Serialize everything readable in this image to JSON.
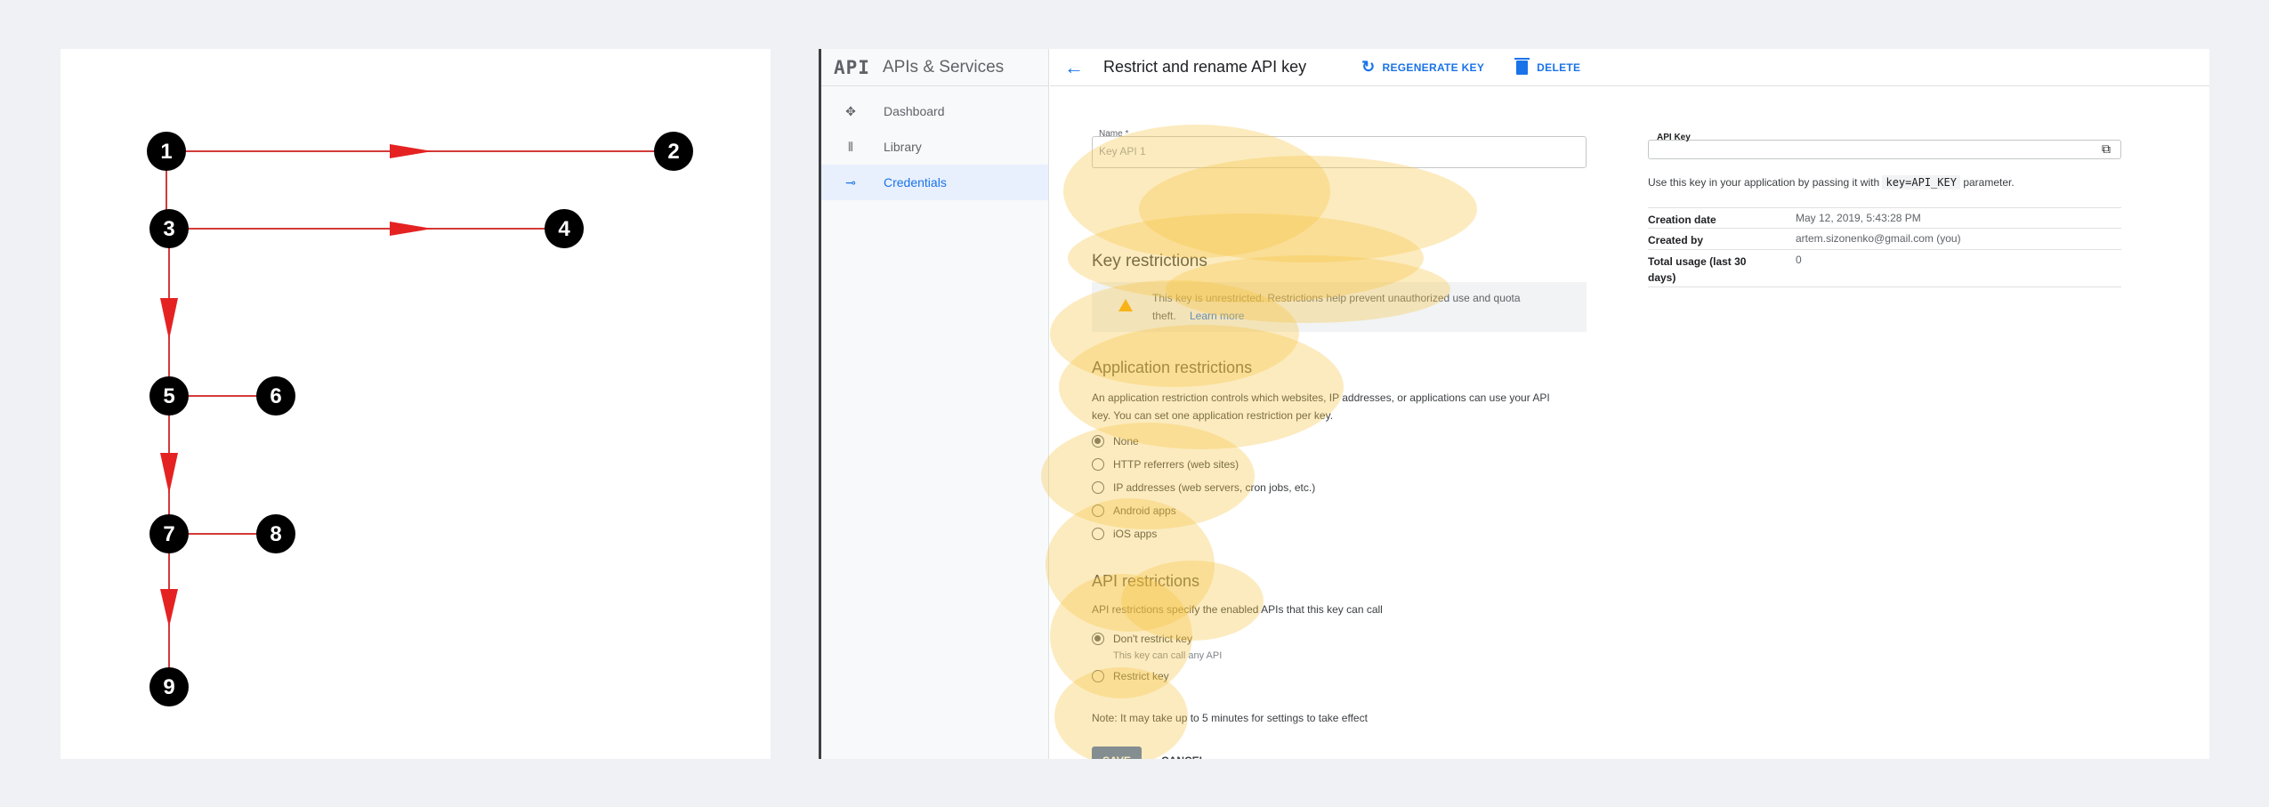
{
  "diagram": {
    "nodes": [
      "1",
      "2",
      "3",
      "4",
      "5",
      "6",
      "7",
      "8",
      "9"
    ]
  },
  "console": {
    "logo": "API",
    "sidebar_title": "APIs & Services",
    "nav": [
      {
        "label": "Dashboard",
        "icon": "dashboard-icon"
      },
      {
        "label": "Library",
        "icon": "library-icon"
      },
      {
        "label": "Credentials",
        "icon": "key-icon",
        "active": true
      }
    ],
    "page_title": "Restrict and rename API key",
    "regenerate_label": "REGENERATE KEY",
    "delete_label": "DELETE",
    "name_field": {
      "label": "Name *",
      "value": "Key API 1"
    },
    "key_restrictions_heading": "Key restrictions",
    "warning_text_1": "This key is unrestricted. Restrictions help prevent unauthorized use and quota",
    "warning_text_2": "theft.",
    "warning_link": "Learn more",
    "app_restrictions_heading": "Application restrictions",
    "app_restrictions_text_1": "An application restriction controls which websites, IP addresses, or applications can use your API",
    "app_restrictions_text_2": "key. You can set one application restriction per key.",
    "app_options": [
      "None",
      "HTTP referrers (web sites)",
      "IP addresses (web servers, cron jobs, etc.)",
      "Android apps",
      "iOS apps"
    ],
    "api_restrictions_heading": "API restrictions",
    "api_restrictions_text": "API restrictions specify the enabled APIs that this key can call",
    "api_options": [
      {
        "label": "Don't restrict key",
        "sub": "This key can call any API"
      },
      {
        "label": "Restrict key",
        "sub": ""
      }
    ],
    "note": "Note: It may take up to 5 minutes for settings to take effect",
    "save_label": "SAVE",
    "cancel_label": "CANCEL",
    "api_key_label": "API Key",
    "usage_text_before": "Use this key in your application by passing it with",
    "usage_code": "key=API_KEY",
    "usage_text_after": "parameter.",
    "info": [
      {
        "key": "Creation date",
        "value": "May 12, 2019, 5:43:28 PM"
      },
      {
        "key": "Created by",
        "value": "artem.sizonenko@gmail.com (you)"
      },
      {
        "key": "Total usage (last 30 days)",
        "value": "0"
      }
    ],
    "heatmap_color": "#f5c343"
  }
}
